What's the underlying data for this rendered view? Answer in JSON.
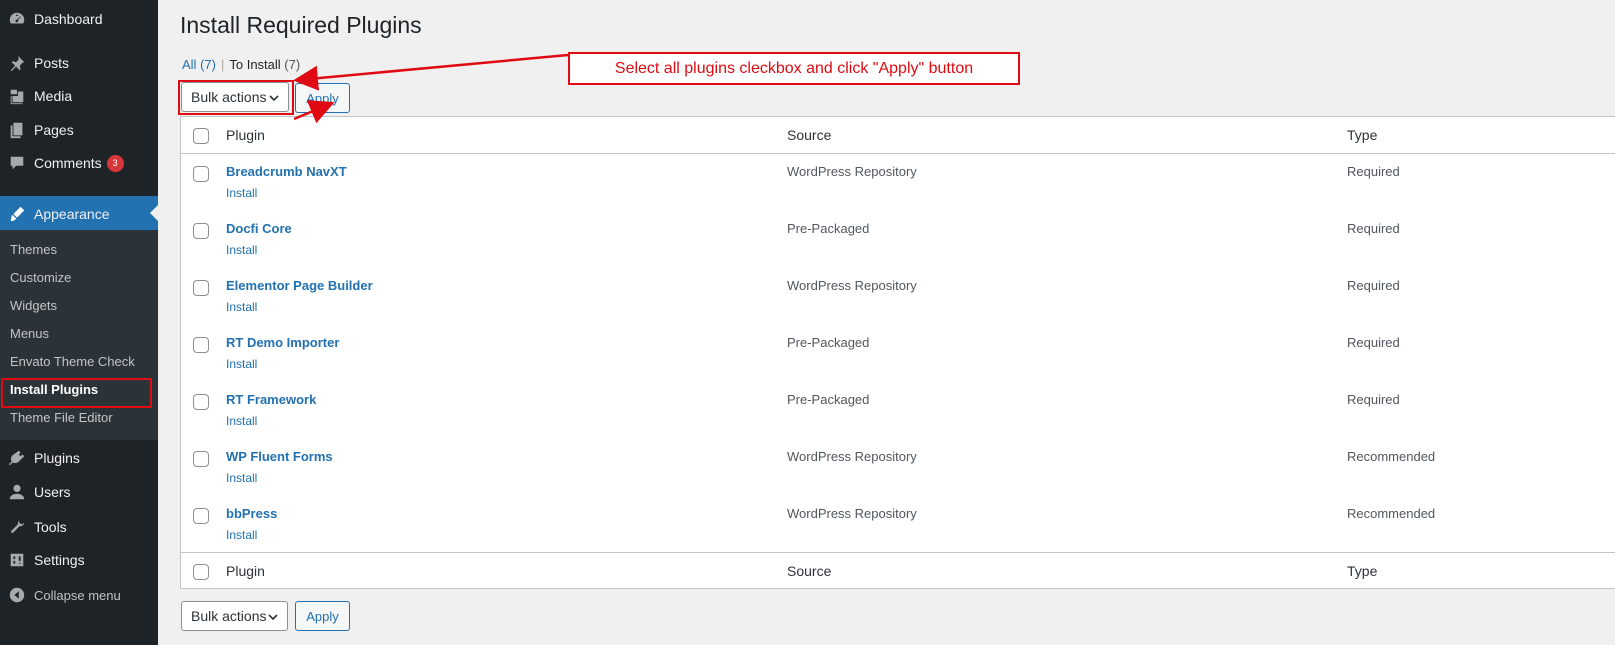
{
  "sidebar": {
    "items": [
      {
        "label": "Dashboard",
        "icon": "dashboard-icon"
      },
      {
        "label": "Posts",
        "icon": "pin-icon"
      },
      {
        "label": "Media",
        "icon": "media-icon"
      },
      {
        "label": "Pages",
        "icon": "pages-icon"
      },
      {
        "label": "Comments",
        "icon": "comment-icon",
        "badge": "3"
      },
      {
        "label": "Appearance",
        "icon": "brush-icon"
      },
      {
        "label": "Plugins",
        "icon": "plugin-icon"
      },
      {
        "label": "Users",
        "icon": "user-icon"
      },
      {
        "label": "Tools",
        "icon": "wrench-icon"
      },
      {
        "label": "Settings",
        "icon": "settings-icon"
      },
      {
        "label": "Collapse menu",
        "icon": "collapse-icon"
      }
    ],
    "submenu": [
      "Themes",
      "Customize",
      "Widgets",
      "Menus",
      "Envato Theme Check",
      "Install Plugins",
      "Theme File Editor"
    ]
  },
  "page": {
    "title": "Install Required Plugins",
    "views": {
      "all_label": "All",
      "all_count": "(7)",
      "separator": "|",
      "install_label": "To Install",
      "install_count": "(7)"
    }
  },
  "bulk": {
    "select_label": "Bulk actions",
    "apply_label": "Apply"
  },
  "table": {
    "headers": {
      "plugin": "Plugin",
      "source": "Source",
      "type": "Type"
    },
    "rows": [
      {
        "name": "Breadcrumb NavXT",
        "action": "Install",
        "source": "WordPress Repository",
        "type": "Required"
      },
      {
        "name": "Docfi Core",
        "action": "Install",
        "source": "Pre-Packaged",
        "type": "Required"
      },
      {
        "name": "Elementor Page Builder",
        "action": "Install",
        "source": "WordPress Repository",
        "type": "Required"
      },
      {
        "name": "RT Demo Importer",
        "action": "Install",
        "source": "Pre-Packaged",
        "type": "Required"
      },
      {
        "name": "RT Framework",
        "action": "Install",
        "source": "Pre-Packaged",
        "type": "Required"
      },
      {
        "name": "WP Fluent Forms",
        "action": "Install",
        "source": "WordPress Repository",
        "type": "Recommended"
      },
      {
        "name": "bbPress",
        "action": "Install",
        "source": "WordPress Repository",
        "type": "Recommended"
      }
    ]
  },
  "annotation": {
    "text": "Select all plugins cleckbox and click \"Apply\" button"
  },
  "colors": {
    "sidebar_bg": "#1d2327",
    "accent": "#2271b1",
    "annotation_red": "#e00b12",
    "badge_red": "#d63638"
  }
}
